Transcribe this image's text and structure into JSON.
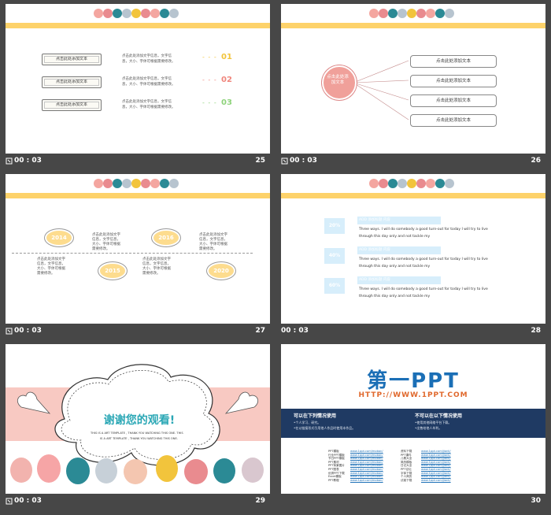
{
  "slides": [
    {
      "time": "00 : 03",
      "number": "25",
      "boxes": [
        "点击此处添加文本",
        "点击此处添加文本",
        "点击此处添加文本"
      ],
      "desc": "点击此处添加文字信息，文字信息，大小、字体可根据需要修改。",
      "nums": [
        "01",
        "02",
        "03"
      ],
      "num_colors": [
        "#f2c43c",
        "#f0867d",
        "#8fd37c"
      ]
    },
    {
      "time": "00 : 03",
      "number": "26",
      "center": "点击此处添加文本",
      "boxes": [
        "点击此处添加文本",
        "点击此处添加文本",
        "点击此处添加文本",
        "点击此处添加文本"
      ]
    },
    {
      "time": "00 : 03",
      "number": "27",
      "years": [
        "2014",
        "2015",
        "2016",
        "2020"
      ],
      "desc": "点击此处添加文字信息，文字信息，大小、字体可根据需要修改。"
    },
    {
      "time": "00 : 03",
      "number": "28",
      "pcts": [
        "20%",
        "40%",
        "60%"
      ],
      "header": "ADD 添加标题 内容",
      "eng1": "Three ways. I will do somebody a good turn-out for today I will try to live",
      "eng2": "through this day only and not tackle my"
    },
    {
      "time": "00 : 03",
      "number": "29",
      "title": "谢谢您的观看!",
      "sub1": "THIS IS A ART TEMPLATE , THANK YOU WATCHING THIS ONE. THIS",
      "sub2": "IS A ART TEMPLATE , THANK YOU WATCHING THIS ONE."
    },
    {
      "time": "",
      "number": "30",
      "brand": "第一PPT",
      "url": "HTTP://WWW.1PPT.COM",
      "can_title": "可以在下列情况使用",
      "can_items": [
        "•个人学习、研究。",
        "•在以链接形式引用他人作品时使用本作品。"
      ],
      "cannot_title": "不可以在以下情况使用",
      "cannot_items": [
        "•使用其他网络平台下载。",
        "•出售给他人牟利。"
      ],
      "links_left": [
        "PPT模板",
        "行业PPT模板",
        "节日PPT模板",
        "PPT素材",
        "PPT背景图片",
        "PPT图表",
        "优秀PPT下载",
        "Excel模板",
        "PPT教程"
      ],
      "links_right": [
        "资料下载",
        "PPT课件",
        "儿歌大全",
        "简历模板",
        "日记大全",
        "PPT论坛",
        "字体下载",
        "个人简历",
        "试卷下载"
      ],
      "url_left": "www.1ppt.com/moban/",
      "url_right": "www.1ppt.com/jianli/"
    }
  ],
  "colors": {
    "bar": "#fdd26a",
    "blue": "#d7eefb",
    "pink": "#f8c9c2",
    "navy": "#1f3a63",
    "brand_blue": "#1b6fb6"
  }
}
